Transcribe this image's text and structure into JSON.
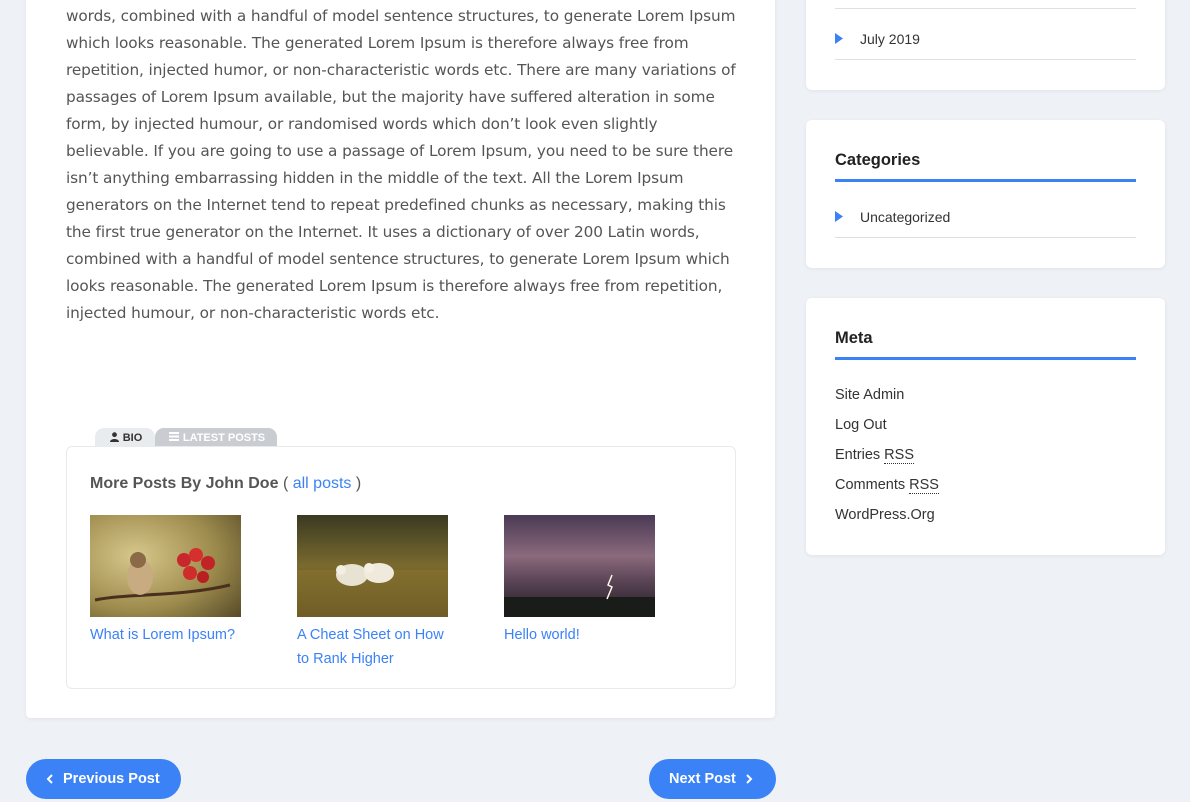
{
  "post": {
    "paragraph": "words, combined with a handful of model sentence structures, to generate Lorem Ipsum which looks reasonable. The generated Lorem Ipsum is therefore always free from repetition, injected humor, or non-characteristic words etc. There are many variations of passages of Lorem Ipsum available, but the majority have suffered alteration in some form, by injected humour, or randomised words which don’t look even slightly believable. If you are going to use a passage of Lorem Ipsum, you need to be sure there isn’t anything embarrassing hidden in the middle of the text. All the Lorem Ipsum generators on the Internet tend to repeat predefined chunks as necessary, making this the first true generator on the Internet. It uses a dictionary of over 200 Latin words, combined with a handful of model sentence structures, to generate Lorem Ipsum which looks reasonable. The generated Lorem Ipsum is therefore always free from repetition, injected humour, or non-characteristic words etc."
  },
  "author_box": {
    "tab_bio": "BIO",
    "tab_latest": "LATEST POSTS",
    "more_title": "More Posts By John Doe",
    "open_paren": "(",
    "all_posts": "all posts",
    "close_paren": ")",
    "posts": [
      {
        "title": "What is Lorem Ipsum?",
        "thumb": "bird-thumbnail"
      },
      {
        "title": "A Cheat Sheet on How to Rank Higher",
        "thumb": "sheep-thumbnail"
      },
      {
        "title": "Hello world!",
        "thumb": "lightning-thumbnail"
      }
    ]
  },
  "nav": {
    "previous": "Previous Post",
    "next": "Next Post"
  },
  "sidebar": {
    "archives": {
      "items": [
        "July 2019"
      ]
    },
    "categories": {
      "title": "Categories",
      "items": [
        "Uncategorized"
      ]
    },
    "meta": {
      "title": "Meta",
      "site_admin": "Site Admin",
      "log_out": "Log Out",
      "entries": "Entries",
      "comments": "Comments",
      "rss": "RSS",
      "wordpress": "WordPress.Org"
    }
  },
  "colors": {
    "accent": "#3b82f6",
    "background": "#eef1f5",
    "card": "#ffffff"
  }
}
